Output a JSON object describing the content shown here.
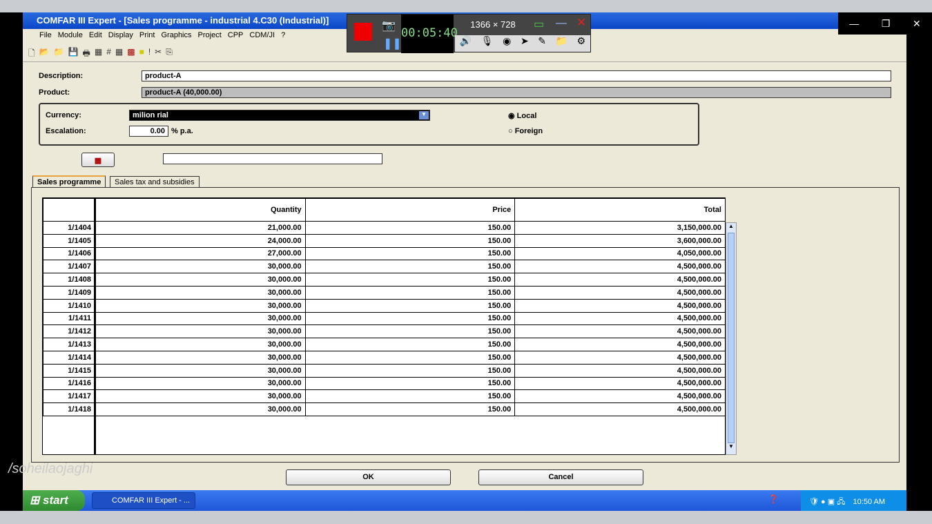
{
  "window": {
    "title": "COMFAR III Expert - [Sales programme - industrial 4.C30 (Industrial)]"
  },
  "menu": [
    "File",
    "Module",
    "Edit",
    "Display",
    "Print",
    "Graphics",
    "Project",
    "CPP",
    "CDM/JI",
    "?"
  ],
  "recorder": {
    "timer": "00:05:40",
    "resolution": "1366 × 728"
  },
  "form": {
    "description_label": "Description:",
    "description_value": "product-A",
    "product_label": "Product:",
    "product_value": "product-A (40,000.00)",
    "currency_label": "Currency:",
    "currency_value": "milion rial",
    "escalation_label": "Escalation:",
    "escalation_value": "0.00",
    "escalation_unit": "% p.a.",
    "local_label": "Local",
    "foreign_label": "Foreign",
    "selected_option": "Local"
  },
  "tabs": [
    {
      "label": "Sales programme",
      "active": true
    },
    {
      "label": "Sales tax and subsidies",
      "active": false
    }
  ],
  "table": {
    "columns": [
      "",
      "Quantity",
      "Price",
      "Total"
    ],
    "rows": [
      [
        "1/1404",
        "21,000.00",
        "150.00",
        "3,150,000.00"
      ],
      [
        "1/1405",
        "24,000.00",
        "150.00",
        "3,600,000.00"
      ],
      [
        "1/1406",
        "27,000.00",
        "150.00",
        "4,050,000.00"
      ],
      [
        "1/1407",
        "30,000.00",
        "150.00",
        "4,500,000.00"
      ],
      [
        "1/1408",
        "30,000.00",
        "150.00",
        "4,500,000.00"
      ],
      [
        "1/1409",
        "30,000.00",
        "150.00",
        "4,500,000.00"
      ],
      [
        "1/1410",
        "30,000.00",
        "150.00",
        "4,500,000.00"
      ],
      [
        "1/1411",
        "30,000.00",
        "150.00",
        "4,500,000.00"
      ],
      [
        "1/1412",
        "30,000.00",
        "150.00",
        "4,500,000.00"
      ],
      [
        "1/1413",
        "30,000.00",
        "150.00",
        "4,500,000.00"
      ],
      [
        "1/1414",
        "30,000.00",
        "150.00",
        "4,500,000.00"
      ],
      [
        "1/1415",
        "30,000.00",
        "150.00",
        "4,500,000.00"
      ],
      [
        "1/1416",
        "30,000.00",
        "150.00",
        "4,500,000.00"
      ],
      [
        "1/1417",
        "30,000.00",
        "150.00",
        "4,500,000.00"
      ],
      [
        "1/1418",
        "30,000.00",
        "150.00",
        "4,500,000.00"
      ]
    ]
  },
  "buttons": {
    "ok": "OK",
    "cancel": "Cancel"
  },
  "watermark": "/soheilaojaghi",
  "taskbar": {
    "start": "start",
    "task": "COMFAR III Expert - ...",
    "clock": "10:50 AM"
  }
}
